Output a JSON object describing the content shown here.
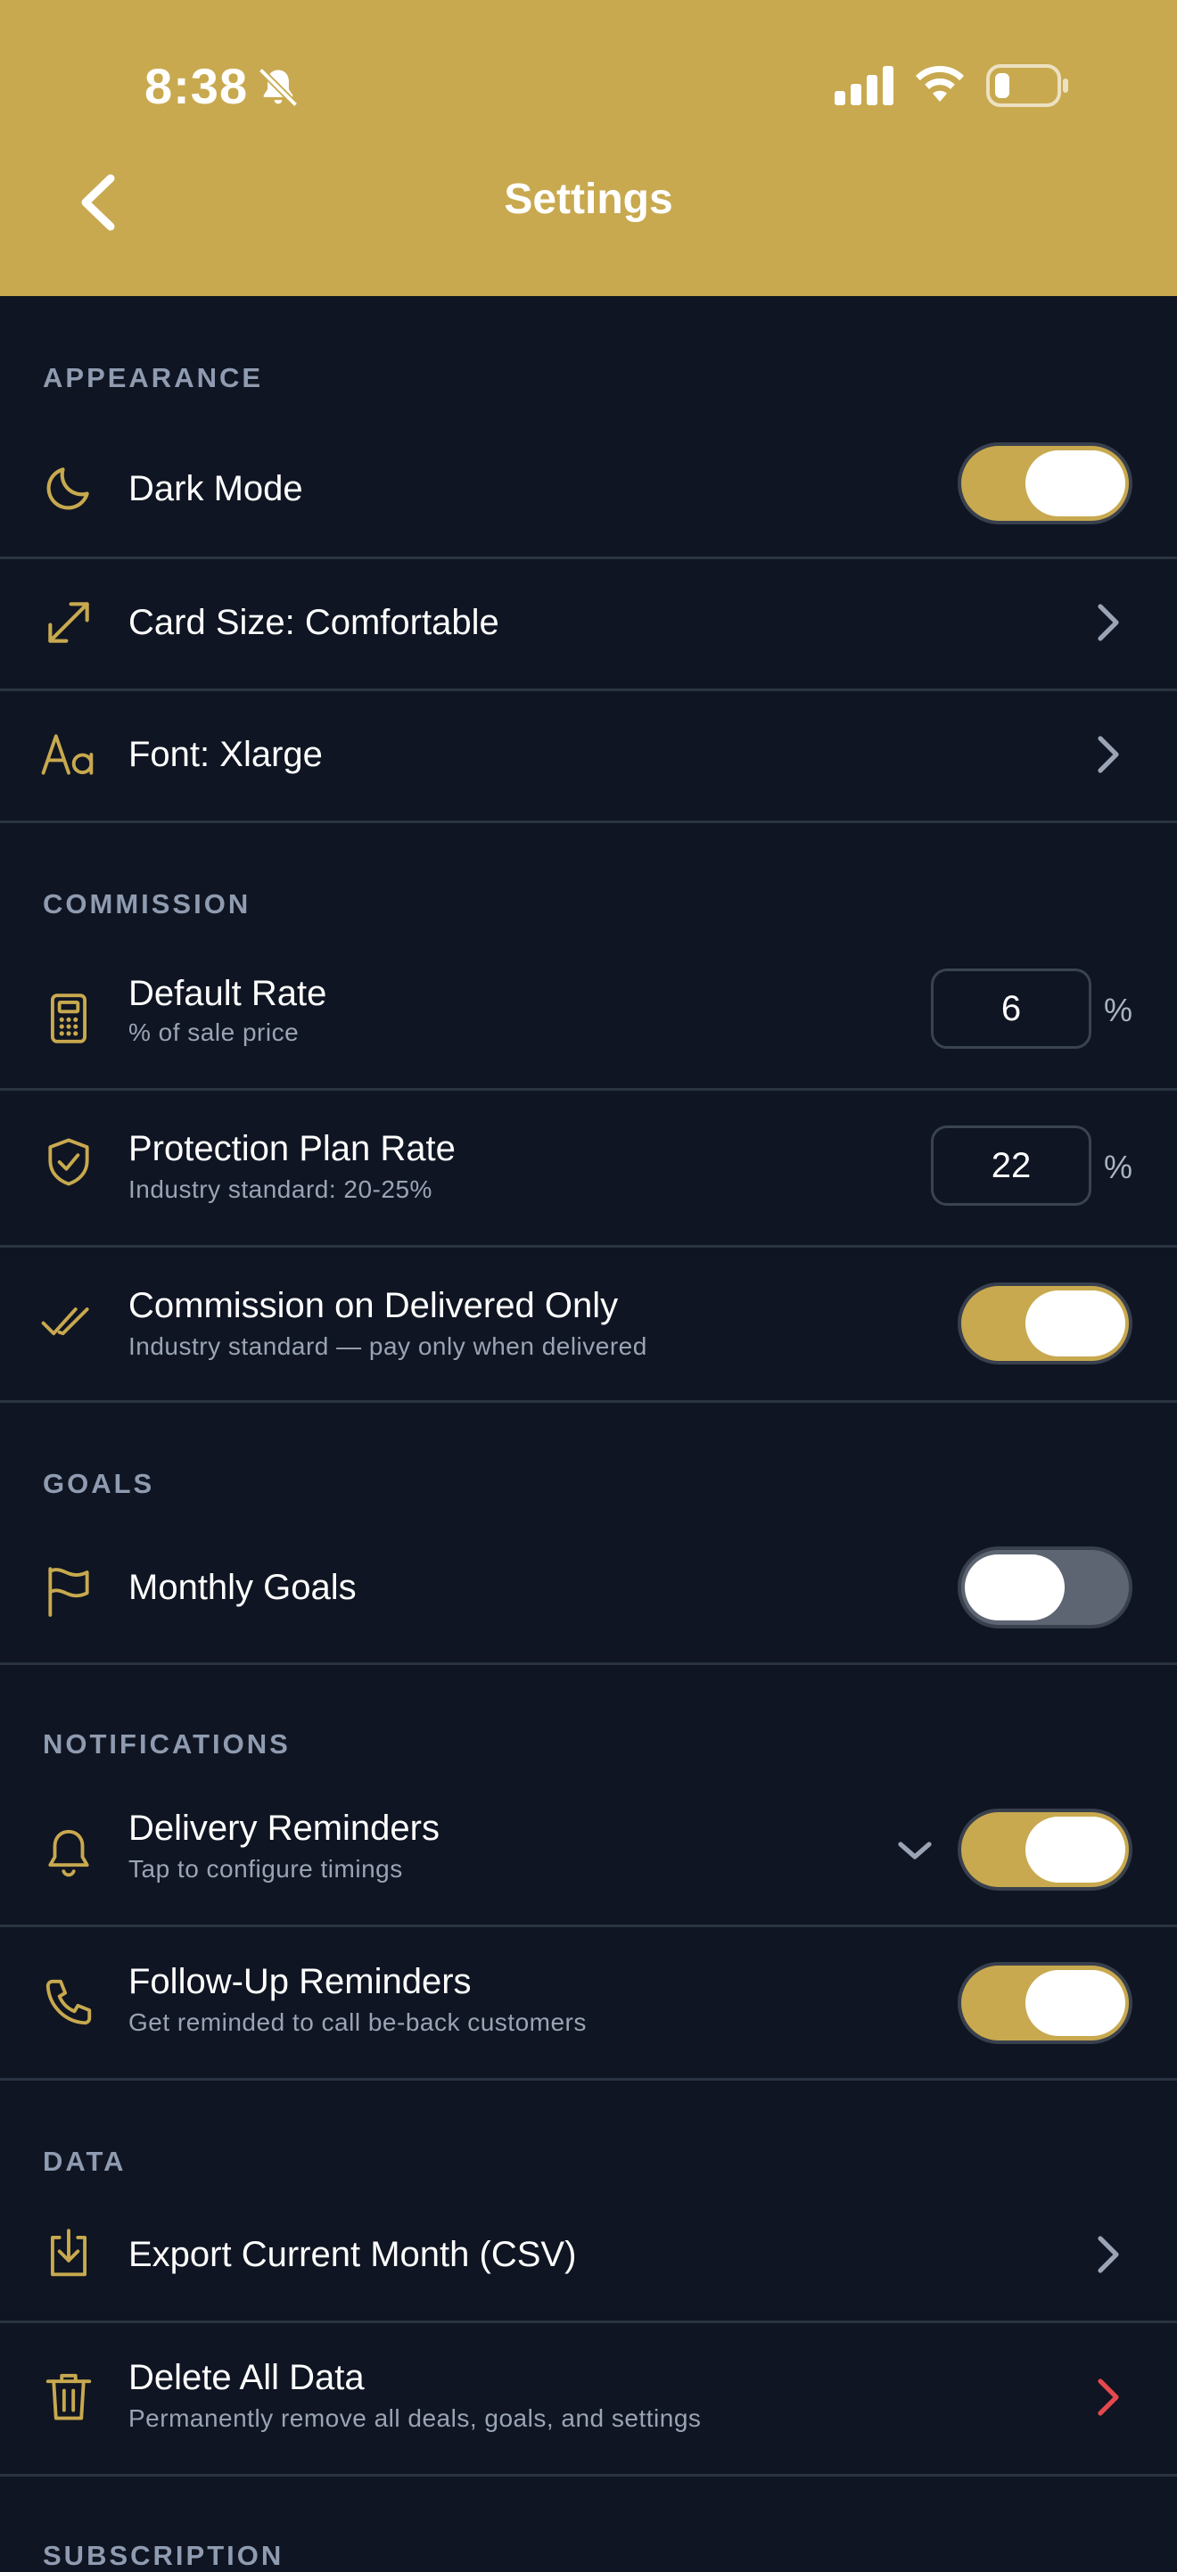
{
  "status_bar": {
    "time": "8:38"
  },
  "header": {
    "title": "Settings"
  },
  "sections": {
    "appearance": "APPEARANCE",
    "commission": "COMMISSION",
    "goals": "GOALS",
    "notifications": "NOTIFICATIONS",
    "data": "DATA",
    "subscription": "SUBSCRIPTION"
  },
  "rows": {
    "dark_mode": {
      "title": "Dark Mode",
      "on": true
    },
    "card_size": {
      "title": "Card Size: Comfortable"
    },
    "font": {
      "title": "Font: Xlarge"
    },
    "default_rate": {
      "title": "Default Rate",
      "subtitle": "% of sale price",
      "value": "6",
      "unit": "%"
    },
    "protection_rate": {
      "title": "Protection Plan Rate",
      "subtitle": "Industry standard: 20-25%",
      "value": "22",
      "unit": "%"
    },
    "delivered_only": {
      "title": "Commission on Delivered Only",
      "subtitle": "Industry standard — pay only when delivered",
      "on": true
    },
    "monthly_goals": {
      "title": "Monthly Goals",
      "on": false
    },
    "delivery_reminders": {
      "title": "Delivery Reminders",
      "subtitle": "Tap to configure timings",
      "on": true
    },
    "followup_reminders": {
      "title": "Follow-Up Reminders",
      "subtitle": "Get reminded to call be-back customers",
      "on": true
    },
    "export": {
      "title": "Export Current Month (CSV)"
    },
    "delete": {
      "title": "Delete All Data",
      "subtitle": "Permanently remove all deals, goals, and settings"
    }
  },
  "colors": {
    "accent": "#c8a94f",
    "background": "#0f1522",
    "danger": "#e5484d",
    "divider": "#2a3342"
  }
}
